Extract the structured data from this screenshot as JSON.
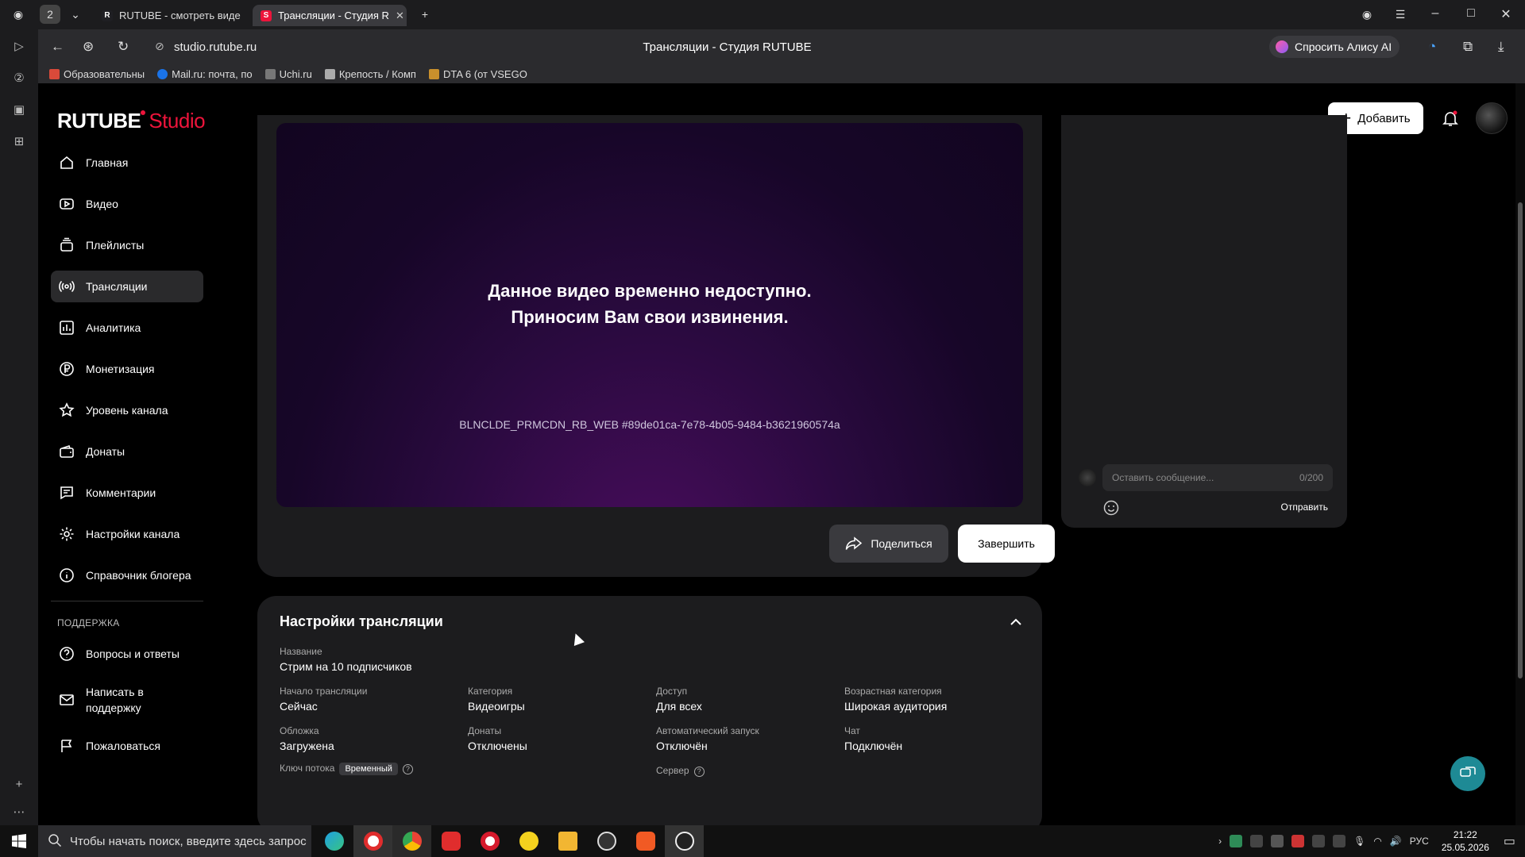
{
  "browser": {
    "tab_count_badge": "2",
    "tabs": [
      {
        "label": "RUTUBE - смотреть виде",
        "favicon_color": "#1f1f23",
        "favicon_letter": "R"
      },
      {
        "label": "Трансляции - Студия R",
        "favicon_color": "#ed143b",
        "favicon_letter": "S"
      }
    ],
    "url": "studio.rutube.ru",
    "page_title": "Трансляции - Студия RUTUBE",
    "alice_label": "Спросить Алису AI",
    "bookmarks": [
      {
        "label": "Образовательны",
        "color": "#d94a3a"
      },
      {
        "label": "Mail.ru: почта, по",
        "color": "#1a73e8"
      },
      {
        "label": "Uchi.ru",
        "color": "#777777"
      },
      {
        "label": "Крепость / Комп",
        "color": "#aaaaaa"
      },
      {
        "label": "DTA 6 (от VSEGO",
        "color": "#c9902c"
      }
    ]
  },
  "header": {
    "logo_main": "RUTUBE",
    "logo_sub": "Studio",
    "add_label": "Добавить"
  },
  "sidebar": {
    "items": [
      {
        "label": "Главная",
        "icon": "home-icon"
      },
      {
        "label": "Видео",
        "icon": "video-icon"
      },
      {
        "label": "Плейлисты",
        "icon": "playlist-icon"
      },
      {
        "label": "Трансляции",
        "icon": "broadcast-icon"
      },
      {
        "label": "Аналитика",
        "icon": "analytics-icon"
      },
      {
        "label": "Монетизация",
        "icon": "ruble-icon"
      },
      {
        "label": "Уровень канала",
        "icon": "star-icon"
      },
      {
        "label": "Донаты",
        "icon": "wallet-icon"
      },
      {
        "label": "Комментарии",
        "icon": "comment-icon"
      },
      {
        "label": "Настройки канала",
        "icon": "gear-icon"
      },
      {
        "label": "Справочник блогера",
        "icon": "info-icon"
      }
    ],
    "support_title": "ПОДДЕРЖКА",
    "support_items": [
      {
        "label": "Вопросы и ответы",
        "icon": "question-icon"
      },
      {
        "label": "Написать в поддержку",
        "icon": "mail-icon"
      },
      {
        "label": "Пожаловаться",
        "icon": "flag-icon"
      }
    ]
  },
  "player": {
    "message_line1": "Данное видео временно недоступно.",
    "message_line2": "Приносим Вам свои извинения.",
    "error_code": "BLNCLDE_PRMCDN_RB_WEB #89de01ca-7e78-4b05-9484-b3621960574a"
  },
  "actions": {
    "share_label": "Поделиться",
    "finish_label": "Завершить"
  },
  "chat": {
    "placeholder": "Оставить сообщение...",
    "counter": "0/200",
    "send_label": "Отправить"
  },
  "settings": {
    "title": "Настройки трансляции",
    "name_label": "Название",
    "name_value": "Стрим на 10 подписчиков",
    "fields": [
      {
        "label": "Начало трансляции",
        "value": "Сейчас"
      },
      {
        "label": "Категория",
        "value": "Видеоигры"
      },
      {
        "label": "Доступ",
        "value": "Для всех"
      },
      {
        "label": "Возрастная категория",
        "value": "Широкая аудитория"
      },
      {
        "label": "Обложка",
        "value": "Загружена"
      },
      {
        "label": "Донаты",
        "value": "Отключены"
      },
      {
        "label": "Автоматический запуск",
        "value": "Отключён"
      },
      {
        "label": "Чат",
        "value": "Подключён"
      }
    ],
    "stream_key_label": "Ключ потока",
    "stream_key_badge": "Временный",
    "server_label": "Сервер"
  },
  "taskbar": {
    "search_placeholder": "Чтобы начать поиск, введите здесь запрос",
    "lang": "РУС",
    "time": "21:22",
    "date": "25.05.2026"
  }
}
